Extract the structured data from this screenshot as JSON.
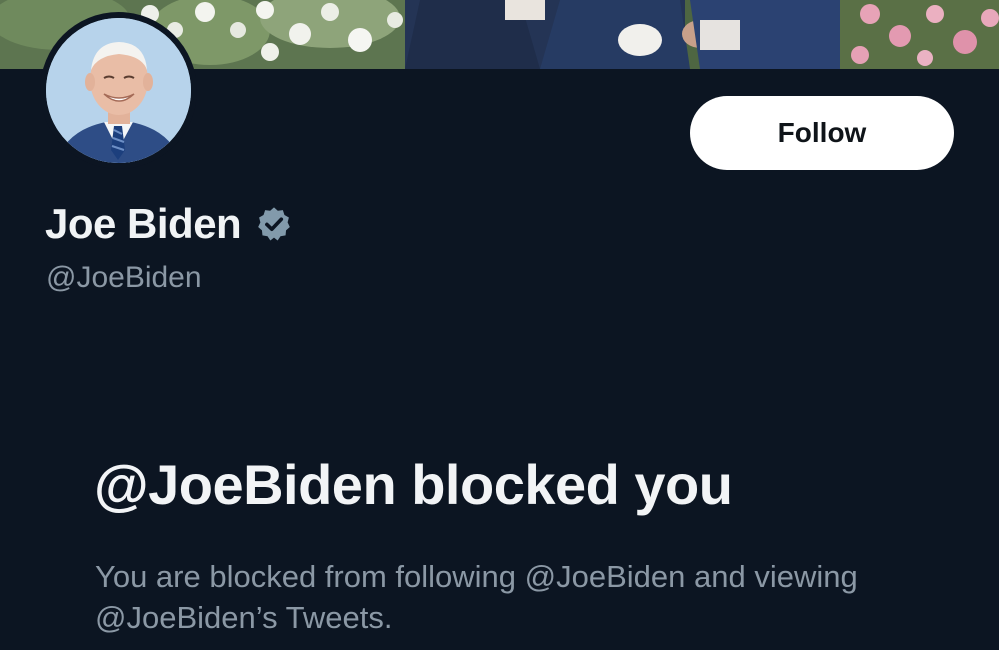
{
  "profile": {
    "display_name": "Joe Biden",
    "handle": "@JoeBiden",
    "verified": true,
    "verified_badge_icon": "verified-badge-icon",
    "avatar_icon": "profile-photo",
    "banner_icon": "banner-photo"
  },
  "actions": {
    "follow_label": "Follow"
  },
  "blocked": {
    "title": "@JoeBiden blocked you",
    "description": "You are blocked from following @JoeBiden and viewing @JoeBiden’s Tweets."
  },
  "colors": {
    "background": "#0c1522",
    "primary_text": "#f0f3f5",
    "secondary_text": "#8b98a5",
    "button_bg": "#ffffff",
    "button_text": "#0f1419",
    "verified_badge": "#829aab"
  }
}
